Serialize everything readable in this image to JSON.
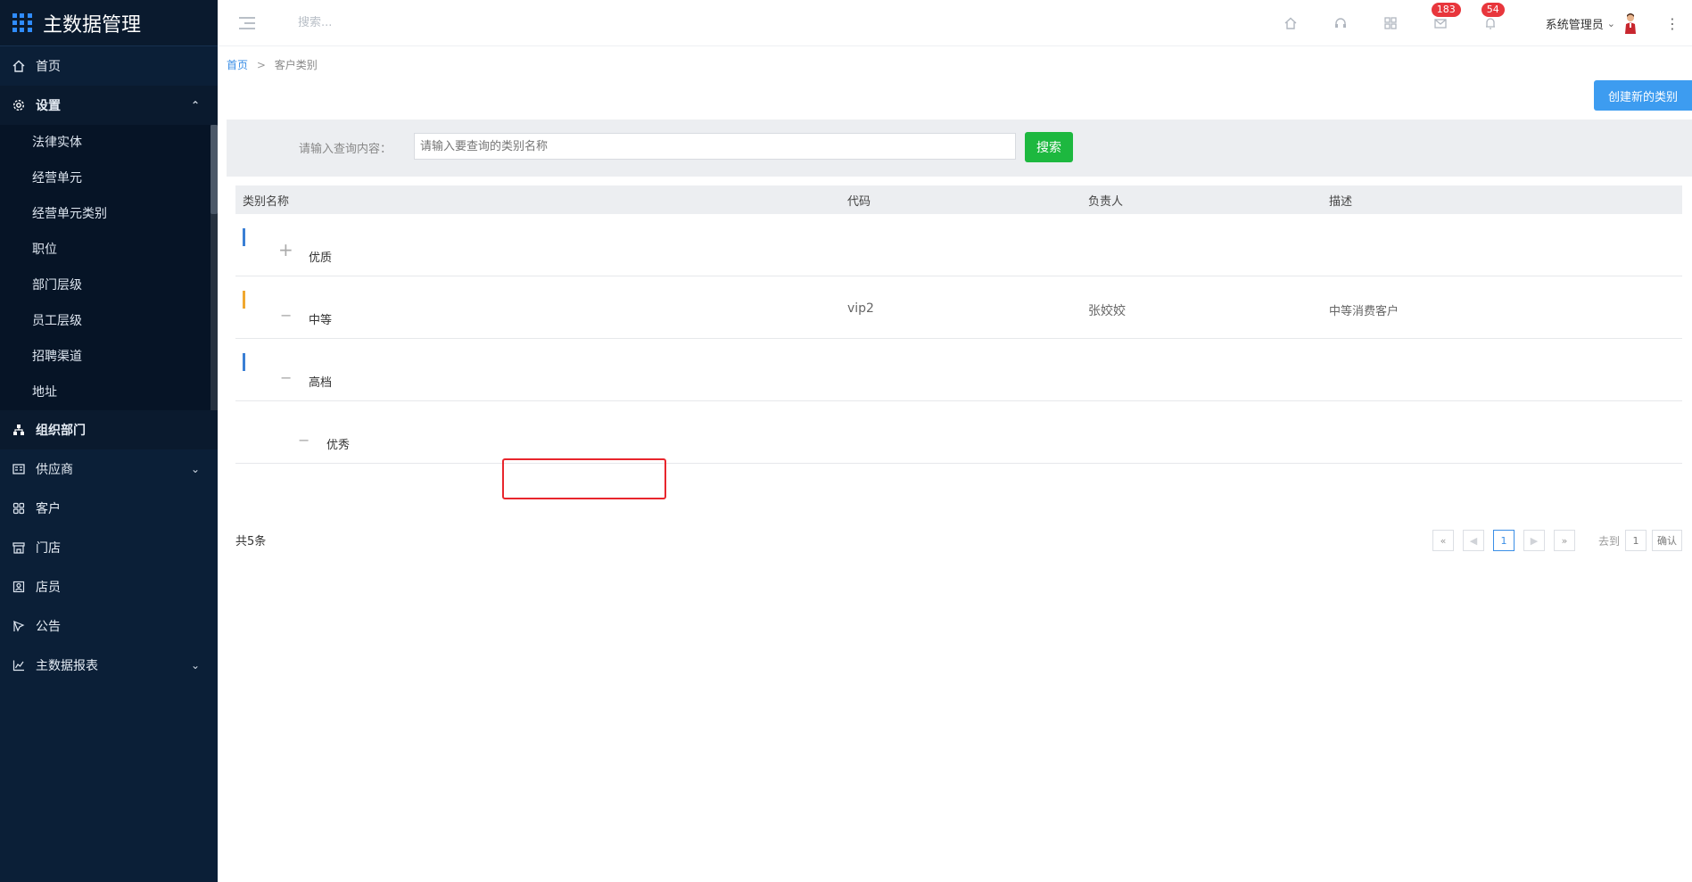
{
  "app": {
    "title": "主数据管理",
    "logo_icon": "grid-logo-icon"
  },
  "sidebar": {
    "items": [
      {
        "label": "首页",
        "icon": "home-icon"
      },
      {
        "label": "设置",
        "icon": "gear-icon",
        "expanded": true
      },
      {
        "label": "组织部门",
        "icon": "org-chart-icon"
      },
      {
        "label": "供应商",
        "icon": "supplier-icon",
        "has_children": true
      },
      {
        "label": "客户",
        "icon": "customer-icon"
      },
      {
        "label": "门店",
        "icon": "store-icon"
      },
      {
        "label": "店员",
        "icon": "clerk-icon"
      },
      {
        "label": "公告",
        "icon": "announcement-icon"
      },
      {
        "label": "主数据报表",
        "icon": "chart-icon",
        "has_children": true
      }
    ],
    "settings_children": [
      "法律实体",
      "经营单元",
      "经营单元类别",
      "职位",
      "部门层级",
      "员工层级",
      "招聘渠道",
      "地址"
    ]
  },
  "topbar": {
    "search_placeholder": "搜索...",
    "mail_badge": "183",
    "bell_badge": "54",
    "user_name": "系统管理员"
  },
  "breadcrumb": {
    "home": "首页",
    "separator": ">",
    "current": "客户类别"
  },
  "actions": {
    "create_label": "创建新的类别"
  },
  "search": {
    "label": "请输入查询内容：",
    "placeholder": "请输入要查询的类别名称",
    "button_label": "搜索"
  },
  "table": {
    "headers": [
      "类别名称",
      "代码",
      "负责人",
      "描述"
    ],
    "rows": [
      {
        "name": "优质",
        "code": "",
        "owner": "",
        "desc": "",
        "toggle": "+",
        "bar_color": "#3a7fd5"
      },
      {
        "name": "中等",
        "code": "vip2",
        "owner": "张姣姣",
        "desc": "中等消费客户",
        "toggle": "−",
        "bar_color": "#f0a830"
      },
      {
        "name": "高档",
        "code": "",
        "owner": "",
        "desc": "",
        "toggle": "−",
        "bar_color": "#3a7fd5"
      },
      {
        "name": "优秀",
        "code": "",
        "owner": "",
        "desc": "",
        "toggle": "−",
        "bar_color": ""
      }
    ]
  },
  "pagination": {
    "total": "共5条",
    "first": "«",
    "prev": "◀",
    "current": "1",
    "next": "▶",
    "last": "»",
    "goto_label": "去到",
    "goto_value": "1",
    "confirm_label": "确认"
  },
  "colors": {
    "sidebar_bg": "#0b1f37",
    "accent_blue": "#3d9cf0",
    "search_green": "#1db83f",
    "badge_red": "#e8363c",
    "highlight_red": "#e8262d"
  }
}
